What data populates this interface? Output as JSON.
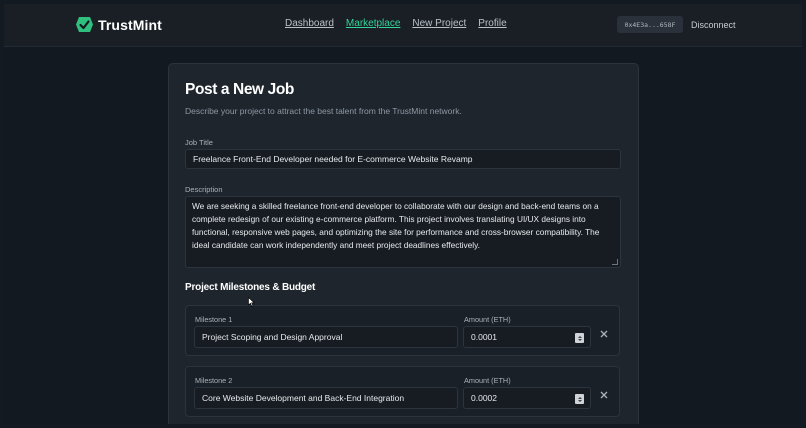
{
  "brand": {
    "name": "TrustMint"
  },
  "nav": [
    {
      "label": "Dashboard",
      "active": false
    },
    {
      "label": "Marketplace",
      "active": true
    },
    {
      "label": "New Project",
      "active": false
    },
    {
      "label": "Profile",
      "active": false
    }
  ],
  "wallet": {
    "address": "0x4E3a...658F",
    "disconnect_label": "Disconnect"
  },
  "form": {
    "title": "Post a New Job",
    "subtitle": "Describe your project to attract the best talent from the TrustMint network.",
    "job_title_label": "Job Title",
    "job_title_value": "Freelance Front-End Developer needed for E-commerce Website Revamp",
    "description_label": "Description",
    "description_value": "We are seeking a skilled freelance front-end developer to collaborate with our design and back-end teams on a complete redesign of our existing e-commerce platform. This project involves translating UI/UX designs into functional, responsive web pages, and optimizing the site for performance and cross-browser compatibility. The ideal candidate can work independently and meet project deadlines effectively.",
    "milestones_heading": "Project Milestones & Budget",
    "milestones": [
      {
        "label": "Milestone 1",
        "name": "Project Scoping and Design Approval",
        "amount_label": "Amount (ETH)",
        "amount": "0.0001"
      },
      {
        "label": "Milestone 2",
        "name": "Core Website Development and Back-End Integration",
        "amount_label": "Amount (ETH)",
        "amount": "0.0002"
      }
    ]
  },
  "colors": {
    "accent": "#34d399",
    "background": "#131920",
    "card": "#1e252d"
  },
  "icons": {
    "logo": "trustmint-logo-icon",
    "remove": "close-icon",
    "stepper": "number-stepper-icon",
    "cursor": "mouse-pointer-icon"
  }
}
